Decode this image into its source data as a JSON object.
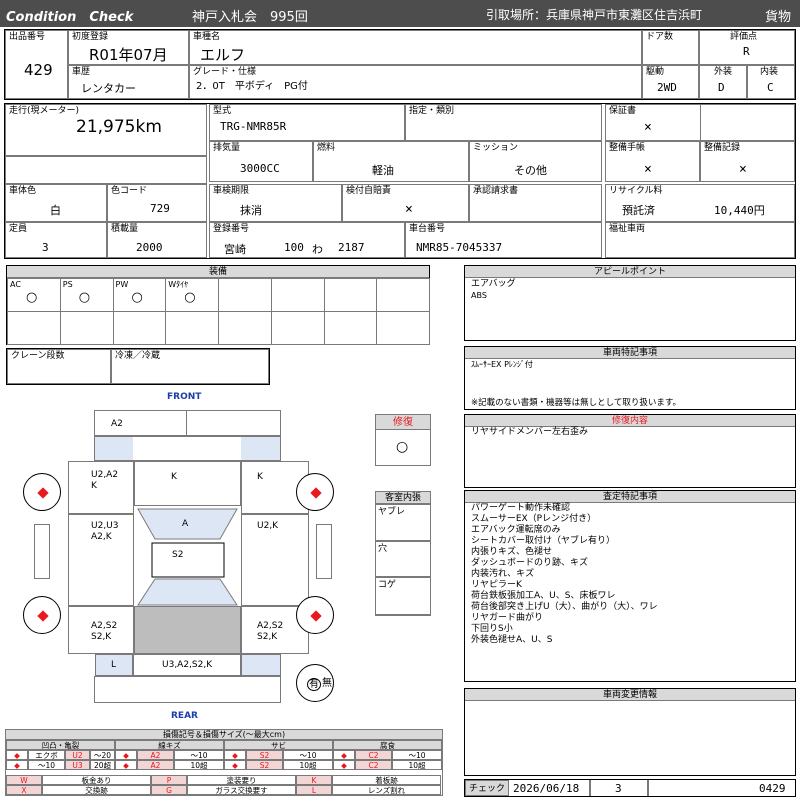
{
  "header": {
    "condition_check": "Condition　Check",
    "auction": "神戸入札会　995回",
    "pickup": "引取場所：兵庫県神戸市東灘区住吉浜町",
    "category": "貨物"
  },
  "row1": {
    "lot_label": "出品番号",
    "lot": "429",
    "first_reg_label": "初度登録",
    "first_reg": "R01年07月",
    "car_name_label": "車種名",
    "car_name": "エルフ",
    "doors_label": "ドア数",
    "doors": "",
    "grade_eval_label": "評価点",
    "grade_eval": "R",
    "history_label": "車歴",
    "history": "レンタカー",
    "grade_label": "グレード・仕様",
    "grade": "2．0T　平ボディ　PG付",
    "drive_label": "駆動",
    "drive": "2WD",
    "exterior_label": "外装",
    "exterior": "D",
    "interior_label": "内装",
    "interior": "C"
  },
  "row2": {
    "mileage_label": "走行(現メーター)",
    "mileage": "21,975km",
    "model_label": "型式",
    "model": "TRG-NMR85R",
    "designation_label": "指定・類別",
    "designation": "",
    "warranty_label": "保証書",
    "warranty": "×",
    "displacement_label": "排気量",
    "displacement": "3000CC",
    "fuel_label": "燃料",
    "fuel": "軽油",
    "mission_label": "ミッション",
    "mission": "その他",
    "maint_book_label": "整備手帳",
    "maint_book": "×",
    "maint_record_label": "整備記録",
    "maint_record": "×",
    "body_color_label": "車体色",
    "body_color": "白",
    "color_code_label": "色コード",
    "color_code": "729",
    "inspection_label": "車検期限",
    "inspection": "抹消",
    "liability_label": "検付自賠責",
    "liability": "×",
    "approval_label": "承認請求書",
    "approval": "",
    "recycle_label": "リサイクル料",
    "recycle_status": "預託済",
    "recycle_fee": "10,440円",
    "capacity_label": "定員",
    "capacity": "3",
    "load_label": "積載量",
    "load": "2000",
    "reg_no_label": "登録番号",
    "reg_area": "宮崎",
    "reg_class": "100",
    "reg_kana": "わ",
    "reg_num": "2187",
    "chassis_label": "車台番号",
    "chassis": "NMR85-7045337",
    "welfare_label": "福祉車両",
    "welfare": ""
  },
  "equipment": {
    "title": "装備",
    "items": [
      {
        "label": "AC",
        "mark": "○"
      },
      {
        "label": "PS",
        "mark": "○"
      },
      {
        "label": "PW",
        "mark": "○"
      },
      {
        "label": "Wﾀｲﾔ",
        "mark": "○"
      }
    ],
    "crane_label": "クレーン段数",
    "crane": "",
    "freezer_label": "冷凍／冷蔵",
    "freezer": ""
  },
  "appeal": {
    "title": "アピールポイント",
    "lines": [
      "エアバッグ",
      "ABS"
    ]
  },
  "special": {
    "title": "車両特記事項",
    "line1": "ｽﾑｰｻｰEX Pﾚﾝｼﾞ付",
    "note": "※記載のない書類・機器等は無しとして取り扱います。"
  },
  "diagram": {
    "front": "FRONT",
    "rear": "REAR",
    "marks": {
      "front_bumper": "A2",
      "left_front_door": "U2,A2\nK",
      "roof_front": "K",
      "right_front_door": "K",
      "left_mid": "U2,U3\nA2,K",
      "center_a": "A",
      "right_mid": "U2,K",
      "center_s2": "S2",
      "left_rear": "A2,S2\nS2,K",
      "right_rear": "A2,S2\nS2,K",
      "rear_left": "L",
      "rear_bumper": "U3,A2,S2,K"
    },
    "yes": "有",
    "no": "無"
  },
  "repair": {
    "title": "修復",
    "mark": "○"
  },
  "cabin": {
    "title": "客室内張",
    "items": [
      "ヤブレ",
      "穴",
      "コゲ"
    ]
  },
  "repair_detail": {
    "title": "修復内容",
    "text": "リヤサイドメンバー左右歪み"
  },
  "inspection_notes": {
    "title": "査定特記事項",
    "lines": [
      "パワーゲート動作未確認",
      "スムーサーEX（Pレンジ付き）",
      "エアバック運転席のみ",
      "シートカバー取付け（ヤブレ有り）",
      "内張りキズ、色褪せ",
      "ダッシュボードのり跡、キズ",
      "内装汚れ、キズ",
      "リヤピラーK",
      "荷台鉄板張加工A、U、S、床板ワレ",
      "荷台後部突き上げU（大）、曲がり（大）、ワレ",
      "リヤガード曲がり",
      "下回りS小",
      "外装色褪せA、U、S"
    ]
  },
  "change_info": {
    "title": "車両変更情報",
    "text": ""
  },
  "legend": {
    "title": "損傷記号＆損傷サイズ(〜最大cm)",
    "heads": [
      "凹凸・亀裂",
      "線キズ",
      "サビ",
      "腐食"
    ],
    "row1": [
      "エクボ",
      "U2",
      "〜20",
      "A2",
      "〜10",
      "S2",
      "〜10",
      "C2",
      "〜10"
    ],
    "row1_sym": [
      "◆",
      "◆",
      "◆",
      "◆"
    ],
    "row2": [
      "〜10",
      "U3",
      "20超",
      "A2",
      "10超",
      "S2",
      "10超",
      "C2",
      "10超"
    ],
    "row2_sym": [
      "◆",
      "◆",
      "◆",
      "◆"
    ],
    "marks": [
      {
        "k": "W",
        "v": "板金あり",
        "k2": "P",
        "v2": "塗装要り",
        "k3": "K",
        "v3": "着板跡"
      },
      {
        "k": "X",
        "v": "交換跡",
        "k2": "G",
        "v2": "ガラス交換要す",
        "k3": "L",
        "v3": "レンズ割れ"
      }
    ]
  },
  "check": {
    "label": "チェック",
    "date": "2026/06/18",
    "num": "3",
    "lot": "0429"
  }
}
